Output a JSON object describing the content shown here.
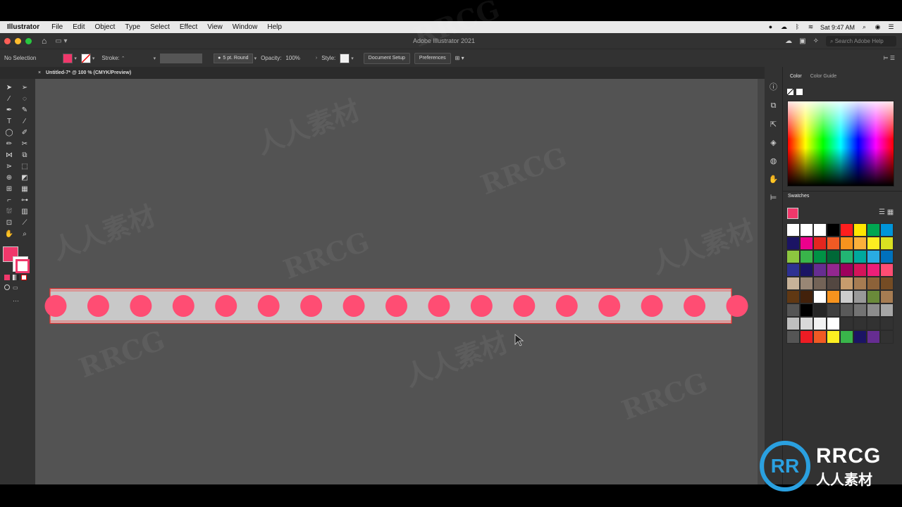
{
  "menubar": {
    "app": "Illustrator",
    "items": [
      "File",
      "Edit",
      "Object",
      "Type",
      "Select",
      "Effect",
      "View",
      "Window",
      "Help"
    ],
    "clock": "Sat 9:47 AM"
  },
  "titlebar": {
    "title": "Adobe Illustrator 2021",
    "search_placeholder": "Search Adobe Help"
  },
  "controlbar": {
    "selection": "No Selection",
    "stroke_label": "Stroke:",
    "brush_value": "5 pt. Round",
    "opacity_label": "Opacity:",
    "opacity_value": "100%",
    "style_label": "Style:",
    "doc_setup": "Document Setup",
    "preferences": "Preferences"
  },
  "document": {
    "tab": "Untitled-7* @ 100 % (CMYK/Preview)"
  },
  "artwork": {
    "dot_count": 17,
    "dot_color": "#ff4d73",
    "strip_color": "#c8c8c8",
    "outline_color": "#ff3030"
  },
  "colors": {
    "fill": "#f0386b",
    "canvas": "#535353",
    "chrome": "#323232"
  },
  "panels": {
    "color_tab": "Color",
    "color_guide_tab": "Color Guide",
    "swatches_title": "Swatches"
  },
  "swatches": {
    "rows": [
      [
        "#ffffff",
        "#ffffff",
        "#ffffff",
        "#000000",
        "#ff1e1e",
        "#ffe600",
        "#00a651",
        "#0095d9"
      ],
      [
        "#1b1464",
        "#ec008c",
        "#e4261f",
        "#f15a24",
        "#f7931e",
        "#fbb03b",
        "#fcee21",
        "#d9e021"
      ],
      [
        "#8cc63f",
        "#39b54a",
        "#009245",
        "#006837",
        "#22b573",
        "#00a99d",
        "#29abe2",
        "#0071bc"
      ],
      [
        "#2e3192",
        "#1b1464",
        "#662d91",
        "#93278f",
        "#9e005d",
        "#d4145a",
        "#ed1e79",
        "#ff4d73"
      ],
      [
        "#c7b299",
        "#998675",
        "#736357",
        "#534741",
        "#c69c6d",
        "#a67c52",
        "#8c6239",
        "#754c24"
      ],
      [
        "#603813",
        "#42210b",
        "#ffffff",
        "#f7931e",
        "#cccccc",
        "#999999",
        "#6a8a3a",
        "#a67c52"
      ],
      [
        "#555555",
        "#000000",
        "#262626",
        "#404040",
        "#595959",
        "#737373",
        "#8c8c8c",
        "#a6a6a6"
      ],
      [
        "#bfbfbf",
        "#d9d9d9",
        "#f2f2f2",
        "#ffffff",
        "#323232",
        "#323232",
        "#323232",
        "#323232"
      ],
      [
        "#555555",
        "#ed1c24",
        "#f15a24",
        "#fcee21",
        "#39b54a",
        "#1b1464",
        "#662d91",
        "#323232"
      ]
    ]
  },
  "watermark": {
    "latin": "RRCG",
    "cjk": "人人素材"
  }
}
